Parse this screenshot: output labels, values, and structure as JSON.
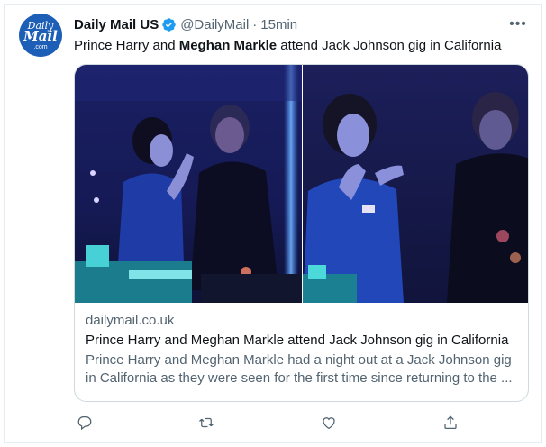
{
  "tweet": {
    "avatar": {
      "line1": "Daily",
      "line2": "Mail",
      "line3": ".com"
    },
    "display_name": "Daily Mail US",
    "handle": "@DailyMail",
    "separator": "·",
    "time": "15min",
    "more_label": "•••",
    "text_prefix": "Prince Harry and ",
    "text_bold": "Meghan Markle",
    "text_suffix": " attend Jack Johnson gig in California"
  },
  "card": {
    "domain": "dailymail.co.uk",
    "title": "Prince Harry and Meghan Markle attend Jack Johnson gig in California",
    "description_line1": "Prince Harry and Meghan Markle had a night out at a Jack Johnson gig",
    "description_line2": "in California as they were seen for the first time since returning to the ..."
  },
  "icons": {
    "verified": "verified-badge-icon",
    "reply": "reply-icon",
    "retweet": "retweet-icon",
    "like": "like-icon",
    "share": "share-icon"
  },
  "colors": {
    "accent": "#1d9bf0",
    "brand": "#1d5fb6",
    "muted": "#536471"
  }
}
